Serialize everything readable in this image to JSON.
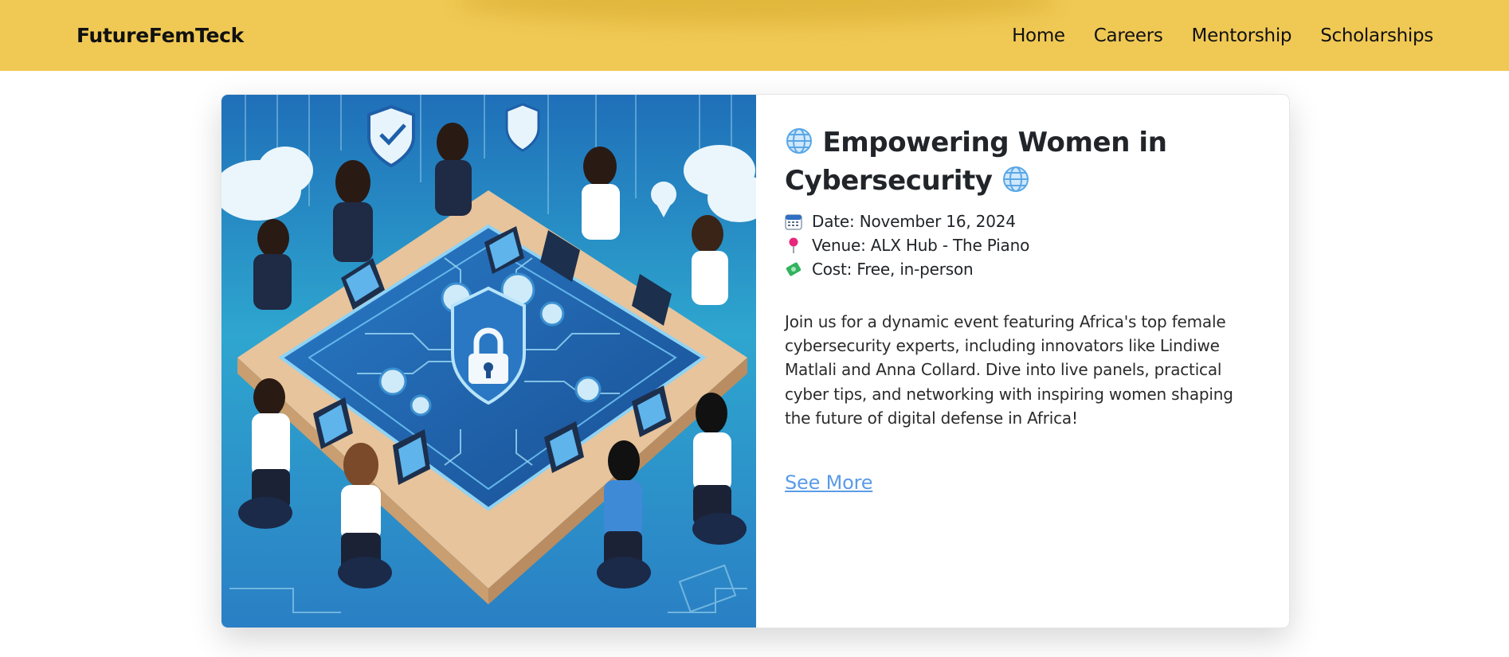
{
  "navbar": {
    "brand": "FutureFemTeck",
    "links": [
      {
        "label": "Home"
      },
      {
        "label": "Careers"
      },
      {
        "label": "Mentorship"
      },
      {
        "label": "Scholarships"
      }
    ]
  },
  "event": {
    "title_line1": "Empowering Women in",
    "title_line2": "Cybersecurity",
    "title_icon": "globe-icon",
    "date": "Date: November 16, 2024",
    "date_icon": "calendar-icon",
    "venue": "Venue: ALX Hub - The Piano",
    "venue_icon": "pushpin-icon",
    "cost": "Cost: Free, in-person",
    "cost_icon": "money-icon",
    "description": "Join us for a dynamic event featuring Africa's top female cybersecurity experts, including innovators like Lindiwe Matlali and Anna Collard. Dive into live panels, practical cyber tips, and networking with inspiring women shaping the future of digital defense in Africa!",
    "cta_label": "See More",
    "image_subject": "illustration of women working on laptops around a cybersecurity table with a padlock shield"
  },
  "colors": {
    "header_bg": "#f0c955",
    "link": "#5b9be8",
    "text": "#212529"
  }
}
